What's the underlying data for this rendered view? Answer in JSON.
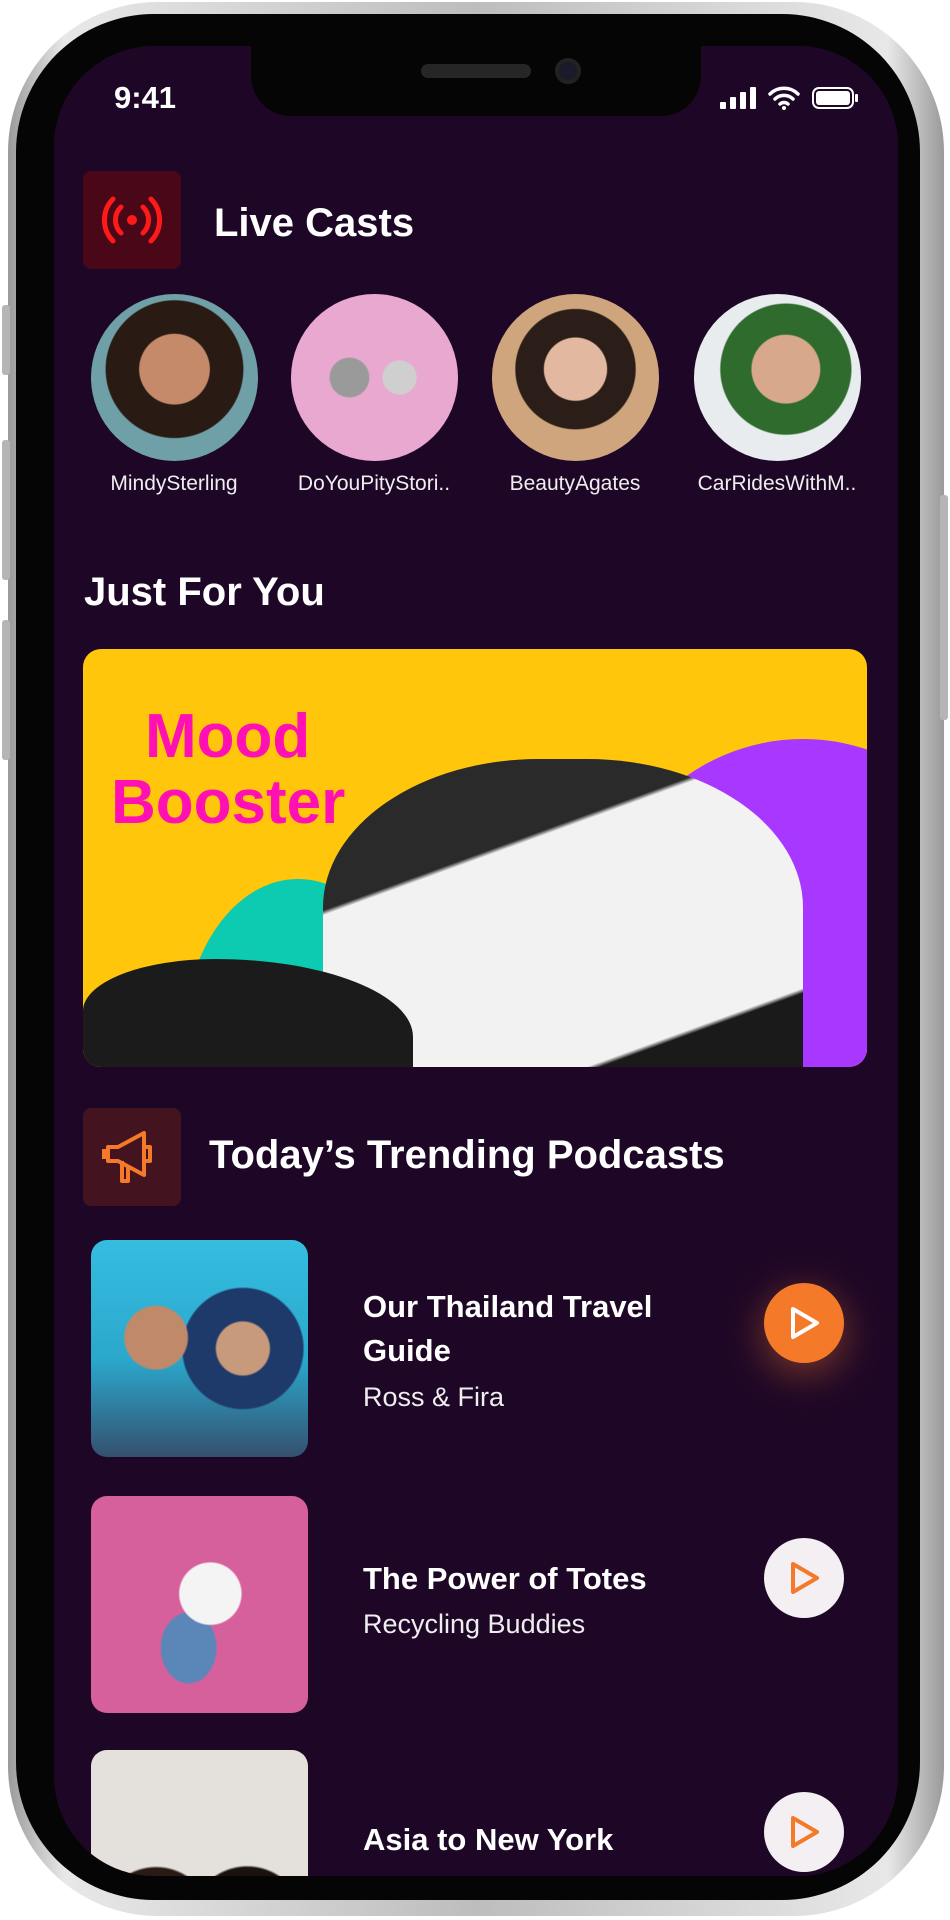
{
  "status_bar": {
    "time": "9:41"
  },
  "live_casts": {
    "title": "Live Casts",
    "icon": "live-broadcast-icon",
    "icon_color": "#ff1a1a",
    "items": [
      {
        "label": "MindySterling"
      },
      {
        "label": "DoYouPityStori.."
      },
      {
        "label": "BeautyAgates"
      },
      {
        "label": "CarRidesWithM.."
      }
    ]
  },
  "just_for_you": {
    "title": "Just For You",
    "banner": {
      "line1": "Mood",
      "line2": "Booster",
      "text_color": "#ff10b4",
      "bg_color": "#ffc60b"
    }
  },
  "trending": {
    "title": "Today’s Trending Podcasts",
    "icon": "megaphone-icon",
    "icon_color": "#f47a2a",
    "items": [
      {
        "title": "Our Thailand Travel Guide",
        "subtitle": "Ross & Fira",
        "active": true
      },
      {
        "title": "The Power of Totes",
        "subtitle": "Recycling Buddies",
        "active": false
      },
      {
        "title": "Asia to New York",
        "subtitle": "",
        "active": false
      }
    ]
  },
  "colors": {
    "background": "#1e0726",
    "accent": "#f47a2a"
  }
}
